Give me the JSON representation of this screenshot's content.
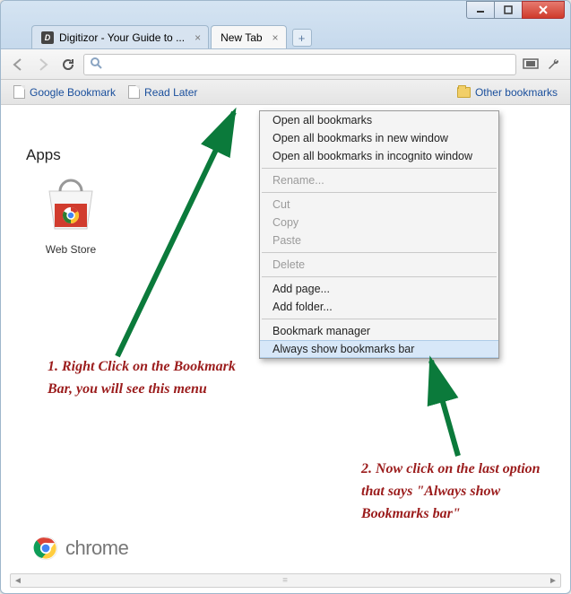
{
  "window": {
    "tabs": [
      {
        "title": "Digitizor - Your Guide to ...",
        "active": false,
        "favicon_letter": "D"
      },
      {
        "title": "New Tab",
        "active": true
      }
    ]
  },
  "toolbar": {
    "omnibox_value": "",
    "omnibox_placeholder": ""
  },
  "bookmarks_bar": {
    "items": [
      {
        "label": "Google Bookmark"
      },
      {
        "label": "Read Later"
      }
    ],
    "other_label": "Other bookmarks"
  },
  "apps": {
    "section_title": "Apps",
    "tiles": [
      {
        "label": "Web Store"
      }
    ]
  },
  "context_menu": {
    "items": [
      {
        "label": "Open all bookmarks",
        "enabled": true
      },
      {
        "label": "Open all bookmarks in new window",
        "enabled": true
      },
      {
        "label": "Open all bookmarks in incognito window",
        "enabled": true
      },
      {
        "sep": true
      },
      {
        "label": "Rename...",
        "enabled": false
      },
      {
        "sep": true
      },
      {
        "label": "Cut",
        "enabled": false
      },
      {
        "label": "Copy",
        "enabled": false
      },
      {
        "label": "Paste",
        "enabled": false
      },
      {
        "sep": true
      },
      {
        "label": "Delete",
        "enabled": false
      },
      {
        "sep": true
      },
      {
        "label": "Add page...",
        "enabled": true
      },
      {
        "label": "Add folder...",
        "enabled": true
      },
      {
        "sep": true
      },
      {
        "label": "Bookmark manager",
        "enabled": true
      },
      {
        "label": "Always show bookmarks bar",
        "enabled": true,
        "highlight": true
      }
    ]
  },
  "annotations": {
    "a1": "1. Right Click on the Bookmark Bar, you will see this menu",
    "a2": "2. Now click on the last option that says \"Always show Bookmarks bar\""
  },
  "footer": {
    "logo_text": "chrome"
  }
}
